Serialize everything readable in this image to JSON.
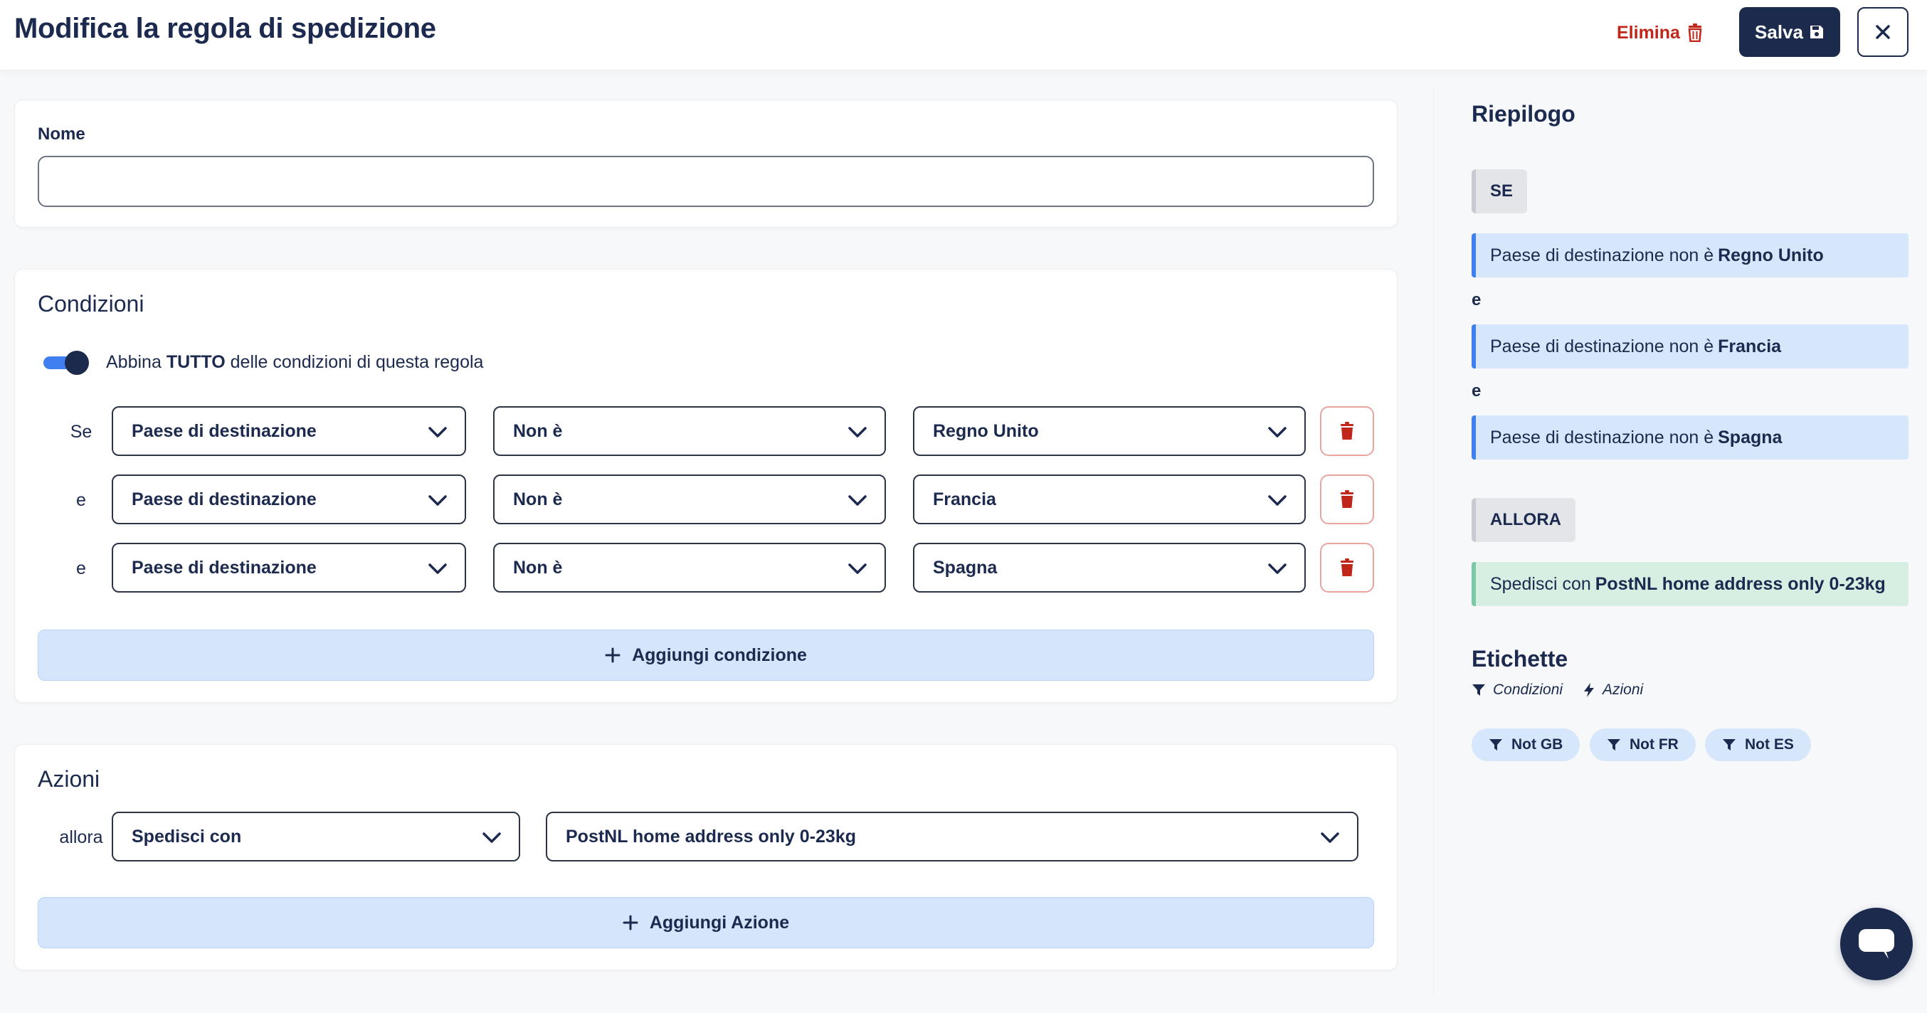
{
  "header": {
    "title": "Modifica la regola di spedizione",
    "delete_label": "Elimina",
    "save_label": "Salva"
  },
  "name_section": {
    "label": "Nome",
    "value": "",
    "placeholder": ""
  },
  "conditions": {
    "title": "Condizioni",
    "toggle_on": true,
    "match_prefix": "Abbina",
    "match_bold": "TUTTO",
    "match_suffix": "delle condizioni di questa regola",
    "rows": [
      {
        "word": "Se",
        "field": "Paese di destinazione",
        "operator": "Non è",
        "value": "Regno Unito"
      },
      {
        "word": "e",
        "field": "Paese di destinazione",
        "operator": "Non è",
        "value": "Francia"
      },
      {
        "word": "e",
        "field": "Paese di destinazione",
        "operator": "Non è",
        "value": "Spagna"
      }
    ],
    "add_label": "Aggiungi condizione"
  },
  "actions": {
    "title": "Azioni",
    "word": "allora",
    "action_type": "Spedisci con",
    "action_value": "PostNL home address only 0-23kg",
    "add_label": "Aggiungi Azione"
  },
  "summary": {
    "title": "Riepilogo",
    "if_label": "SE",
    "then_label": "ALLORA",
    "and_word": "e",
    "conditions": [
      {
        "text": "Paese di destinazione non è",
        "bold": "Regno Unito"
      },
      {
        "text": "Paese di destinazione non è",
        "bold": "Francia"
      },
      {
        "text": "Paese di destinazione non è",
        "bold": "Spagna"
      }
    ],
    "action": {
      "text": "Spedisci con",
      "bold": "PostNL home address only 0-23kg"
    }
  },
  "tags": {
    "title": "Etichette",
    "legend_conditions": "Condizioni",
    "legend_actions": "Azioni",
    "items": [
      "Not GB",
      "Not FR",
      "Not ES"
    ]
  },
  "colors": {
    "primary": "#1c2b4d",
    "danger": "#c0261a",
    "accent_blue": "#3f7ff0",
    "light_blue": "#d6e6fb",
    "light_green": "#d7eee3"
  },
  "icons": [
    "trash-icon",
    "floppy-disk-icon",
    "close-icon",
    "chevron-down-icon",
    "plus-icon",
    "filter-icon",
    "bolt-icon",
    "chat-icon"
  ]
}
